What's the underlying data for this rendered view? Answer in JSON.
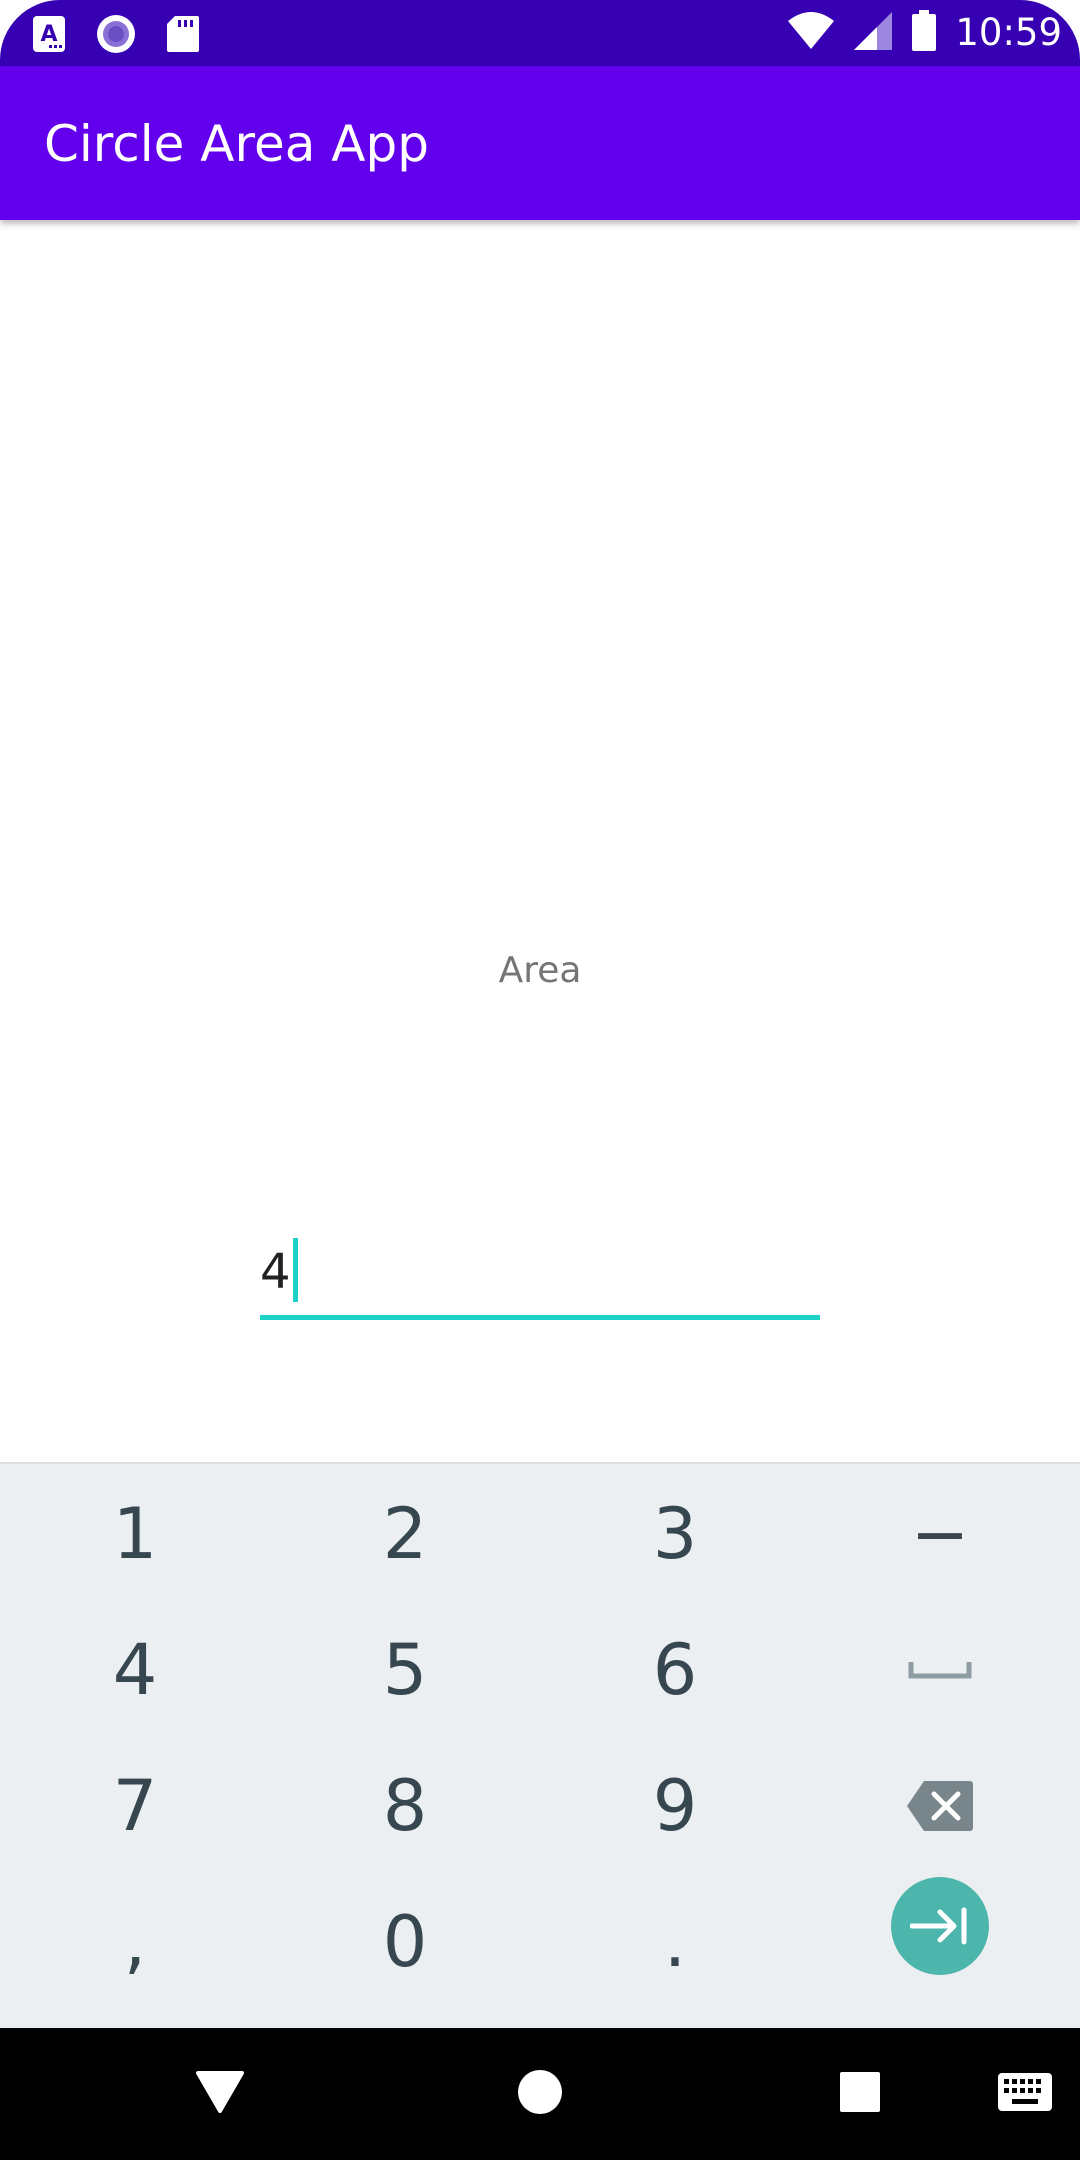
{
  "status_bar": {
    "time": "10:59",
    "left_icons": [
      "accessibility-a-icon",
      "record-circle-icon",
      "sd-card-icon"
    ],
    "right_icons": [
      "wifi-icon",
      "cell-signal-icon",
      "battery-icon"
    ]
  },
  "app_bar": {
    "title": "Circle Area App"
  },
  "content": {
    "area_label": "Area",
    "radius_input": {
      "value": "4"
    }
  },
  "keyboard": {
    "rows": [
      [
        "1",
        "2",
        "3",
        "−"
      ],
      [
        "4",
        "5",
        "6",
        "space-icon"
      ],
      [
        "7",
        "8",
        "9",
        "backspace-icon"
      ],
      [
        ",",
        "0",
        ".",
        "next-field-icon"
      ]
    ],
    "accent_color": "#4DB6AC"
  },
  "nav_bar": {
    "buttons": [
      "back-icon",
      "home-icon",
      "recents-icon",
      "keyboard-switch-icon"
    ]
  },
  "colors": {
    "status_bar": "#3700B3",
    "app_bar": "#6200EE",
    "input_underline": "#1CD1C6",
    "keyboard_bg": "#ECEFF1",
    "key_text": "#37474F"
  }
}
